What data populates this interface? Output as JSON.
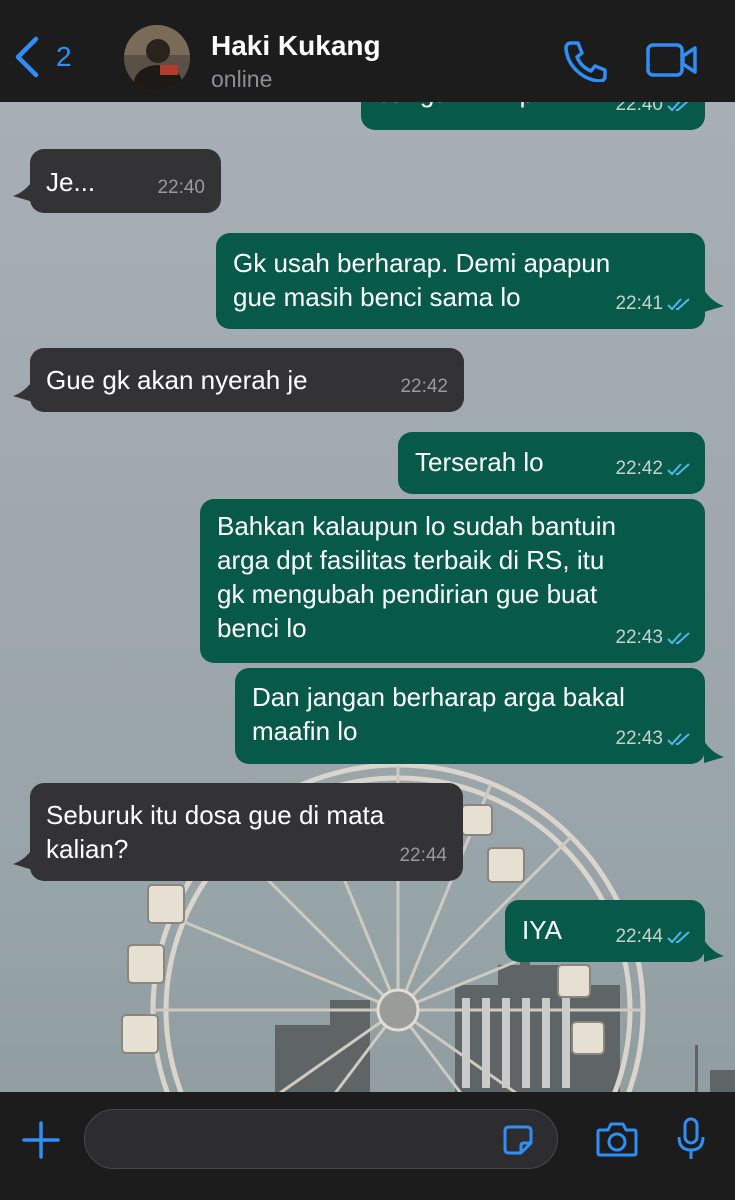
{
  "header": {
    "back_count": "2",
    "contact_name": "Haki Kukang",
    "contact_status": "online"
  },
  "messages": [
    {
      "direction": "out",
      "text_lines": [
        "Jangan mimpi"
      ],
      "time": "22:40",
      "read": true
    },
    {
      "direction": "in",
      "text_lines": [
        "Je..."
      ],
      "time": "22:40"
    },
    {
      "direction": "out",
      "text_lines": [
        "Gk usah berharap. Demi apapun",
        "gue masih benci sama lo"
      ],
      "time": "22:41",
      "read": true
    },
    {
      "direction": "in",
      "text_lines": [
        "Gue gk akan nyerah je"
      ],
      "time": "22:42"
    },
    {
      "direction": "out",
      "text_lines": [
        "Terserah lo"
      ],
      "time": "22:42",
      "read": true
    },
    {
      "direction": "out",
      "text_lines": [
        "Bahkan kalaupun lo sudah bantuin",
        "arga dpt fasilitas terbaik di RS, itu",
        "gk mengubah pendirian gue buat",
        "benci lo"
      ],
      "time": "22:43",
      "read": true
    },
    {
      "direction": "out",
      "text_lines": [
        "Dan jangan berharap arga bakal",
        "maafin lo"
      ],
      "time": "22:43",
      "read": true
    },
    {
      "direction": "in",
      "text_lines": [
        "Seburuk itu dosa gue di mata",
        "kalian?"
      ],
      "time": "22:44"
    },
    {
      "direction": "out",
      "text_lines": [
        "IYA"
      ],
      "time": "22:44",
      "read": true
    }
  ],
  "input": {
    "placeholder": ""
  },
  "icons": {
    "back": "chevron-left-icon",
    "call": "phone-icon",
    "video": "video-camera-icon",
    "attach": "plus-icon",
    "sticker": "sticker-icon",
    "camera": "camera-icon",
    "mic": "microphone-icon",
    "read_receipt": "double-check-icon"
  },
  "colors": {
    "accent": "#2f8ff7",
    "outgoing_bubble": "#075a49",
    "incoming_bubble": "#333335",
    "bar_background": "#1c1c1d",
    "read_tick": "#4fb6ec"
  }
}
